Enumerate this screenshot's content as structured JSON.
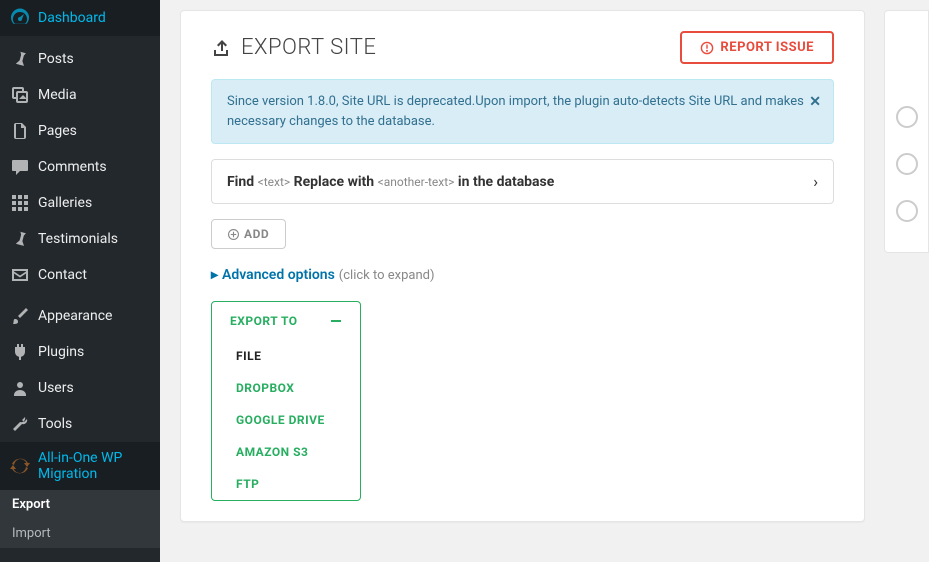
{
  "sidebar": {
    "items": [
      {
        "label": "Dashboard",
        "icon": "gauge"
      },
      {
        "label": "Posts",
        "icon": "pin"
      },
      {
        "label": "Media",
        "icon": "media"
      },
      {
        "label": "Pages",
        "icon": "pages"
      },
      {
        "label": "Comments",
        "icon": "comment"
      },
      {
        "label": "Galleries",
        "icon": "grid"
      },
      {
        "label": "Testimonials",
        "icon": "pin"
      },
      {
        "label": "Contact",
        "icon": "mail"
      },
      {
        "label": "Appearance",
        "icon": "brush"
      },
      {
        "label": "Plugins",
        "icon": "plug"
      },
      {
        "label": "Users",
        "icon": "user"
      },
      {
        "label": "Tools",
        "icon": "wrench"
      },
      {
        "label": "All-in-One WP Migration",
        "icon": "spin"
      }
    ],
    "submenu": [
      {
        "label": "Export",
        "current": true
      },
      {
        "label": "Import",
        "current": false
      }
    ]
  },
  "panel": {
    "title": "EXPORT SITE",
    "report_button": "REPORT ISSUE",
    "alert_text": "Since version 1.8.0, Site URL is deprecated.Upon import, the plugin auto-detects Site URL and makes necessary changes to the database.",
    "find_prefix": "Find ",
    "find_ph1": "<text>",
    "find_mid": " Replace with ",
    "find_ph2": "<another-text>",
    "find_suffix": " in the database",
    "add_button": "ADD",
    "advanced_label": "Advanced options",
    "advanced_hint": "(click to expand)",
    "export_to_label": "EXPORT TO",
    "export_options": [
      {
        "label": "FILE",
        "current": true
      },
      {
        "label": "DROPBOX",
        "current": false
      },
      {
        "label": "GOOGLE DRIVE",
        "current": false
      },
      {
        "label": "AMAZON S3",
        "current": false
      },
      {
        "label": "FTP",
        "current": false
      }
    ]
  }
}
